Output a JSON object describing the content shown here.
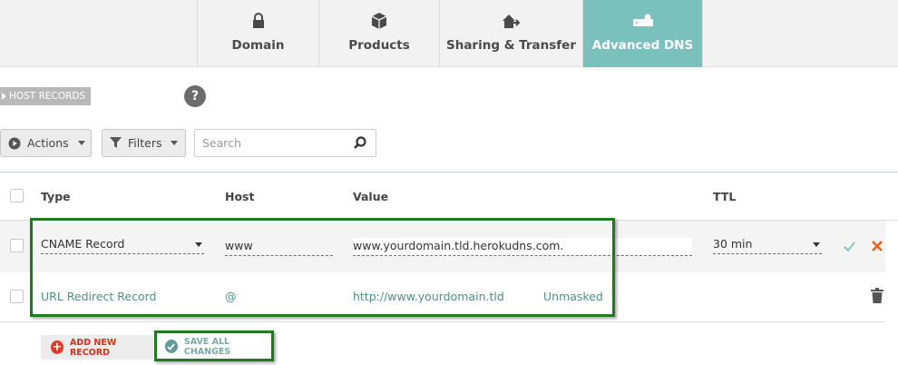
{
  "tabs": [
    {
      "label": "Domain",
      "icon": "lock-icon",
      "active": false
    },
    {
      "label": "Products",
      "icon": "box-icon",
      "active": false
    },
    {
      "label": "Sharing & Transfer",
      "icon": "house-share-icon",
      "active": false
    },
    {
      "label": "Advanced DNS",
      "icon": "server-icon",
      "active": true
    }
  ],
  "section": {
    "host_records_label": "HOST RECORDS",
    "help": "?"
  },
  "toolbar": {
    "actions_label": "Actions",
    "filters_label": "Filters",
    "search_placeholder": "Search"
  },
  "table": {
    "headers": {
      "type": "Type",
      "host": "Host",
      "value": "Value",
      "ttl": "TTL"
    },
    "rows": [
      {
        "type": "CNAME Record",
        "host": "www",
        "value": "www.yourdomain.tld.herokudns.com.",
        "ttl": "30 min",
        "editing": true
      },
      {
        "type": "URL Redirect Record",
        "host": "@",
        "value": "http://www.yourdomain.tld",
        "mode": "Unmasked",
        "editing": false
      }
    ]
  },
  "footer": {
    "add_label": "ADD NEW RECORD",
    "save_label": "SAVE ALL CHANGES"
  },
  "colors": {
    "accent_teal": "#7ac0bd",
    "highlight_green": "#1f7a1f",
    "danger": "#d0321f"
  }
}
